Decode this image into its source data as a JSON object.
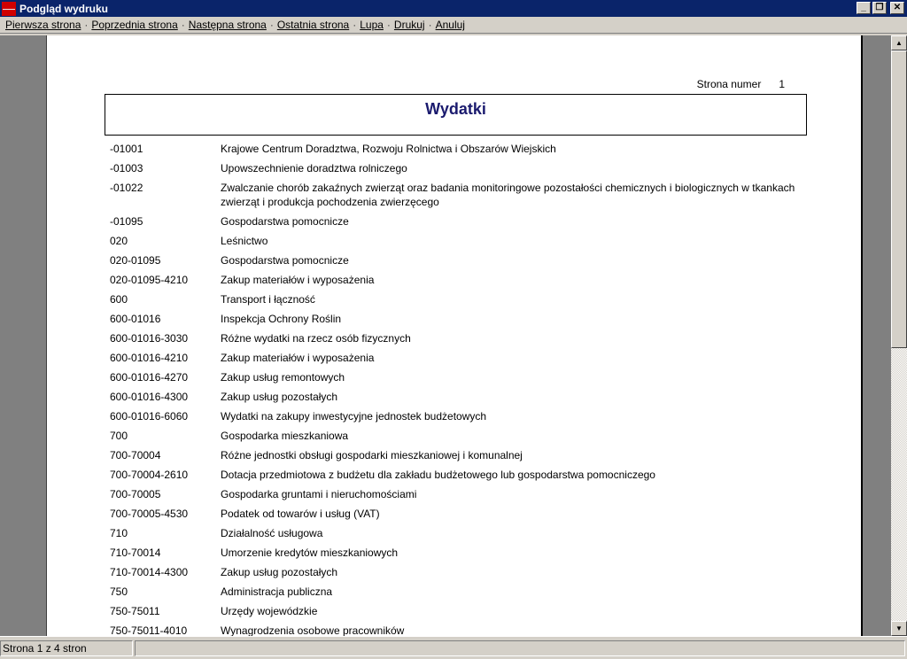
{
  "window": {
    "title": "Podgląd wydruku",
    "controls": {
      "minimize": "_",
      "maximize": "❐",
      "close": "✕"
    }
  },
  "menu": [
    "Pierwsza strona",
    "Poprzednia strona",
    "Następna strona",
    "Ostatnia strona",
    "Lupa",
    "Drukuj",
    "Anuluj"
  ],
  "menu_separator": "·",
  "report": {
    "page_label": "Strona numer",
    "page_number": "1",
    "title": "Wydatki",
    "rows": [
      {
        "code": "-01001",
        "name": "Krajowe Centrum Doradztwa, Rozwoju Rolnictwa i Obszarów Wiejskich"
      },
      {
        "code": "-01003",
        "name": "Upowszechnienie doradztwa rolniczego"
      },
      {
        "code": "-01022",
        "name": "Zwalczanie chorób zakaźnych zwierząt oraz badania monitoringowe pozostałości chemicznych i biologicznych w tkankach zwierząt i produkcja pochodzenia zwierzęcego"
      },
      {
        "code": "-01095",
        "name": "Gospodarstwa pomocnicze"
      },
      {
        "code": "020",
        "name": "Leśnictwo"
      },
      {
        "code": "020-01095",
        "name": "Gospodarstwa pomocnicze"
      },
      {
        "code": "020-01095-4210",
        "name": "Zakup materiałów i wyposażenia"
      },
      {
        "code": "600",
        "name": "Transport i łączność"
      },
      {
        "code": "600-01016",
        "name": "Inspekcja Ochrony Roślin"
      },
      {
        "code": "600-01016-3030",
        "name": "Różne wydatki na rzecz osób fizycznych"
      },
      {
        "code": "600-01016-4210",
        "name": "Zakup materiałów i wyposażenia"
      },
      {
        "code": "600-01016-4270",
        "name": "Zakup usług remontowych"
      },
      {
        "code": "600-01016-4300",
        "name": "Zakup usług pozostałych"
      },
      {
        "code": "600-01016-6060",
        "name": "Wydatki na zakupy inwestycyjne jednostek budżetowych"
      },
      {
        "code": "700",
        "name": "Gospodarka mieszkaniowa"
      },
      {
        "code": "700-70004",
        "name": "Różne jednostki obsługi gospodarki mieszkaniowej i komunalnej"
      },
      {
        "code": "700-70004-2610",
        "name": "Dotacja przedmiotowa z budżetu dla zakładu budżetowego lub gospodarstwa pomocniczego"
      },
      {
        "code": "700-70005",
        "name": "Gospodarka gruntami i nieruchomościami"
      },
      {
        "code": "700-70005-4530",
        "name": "Podatek od towarów i usług (VAT)"
      },
      {
        "code": "710",
        "name": "Działalność usługowa"
      },
      {
        "code": "710-70014",
        "name": "Umorzenie kredytów mieszkaniowych"
      },
      {
        "code": "710-70014-4300",
        "name": "Zakup usług pozostałych"
      },
      {
        "code": "750",
        "name": "Administracja publiczna"
      },
      {
        "code": "750-75011",
        "name": "Urzędy wojewódzkie"
      },
      {
        "code": "750-75011-4010",
        "name": "Wynagrodzenia osobowe pracowników"
      }
    ]
  },
  "status": {
    "page_info": "Strona 1 z 4 stron",
    "secondary": ""
  },
  "scrollbar": {
    "up_icon": "▲",
    "down_icon": "▼"
  }
}
